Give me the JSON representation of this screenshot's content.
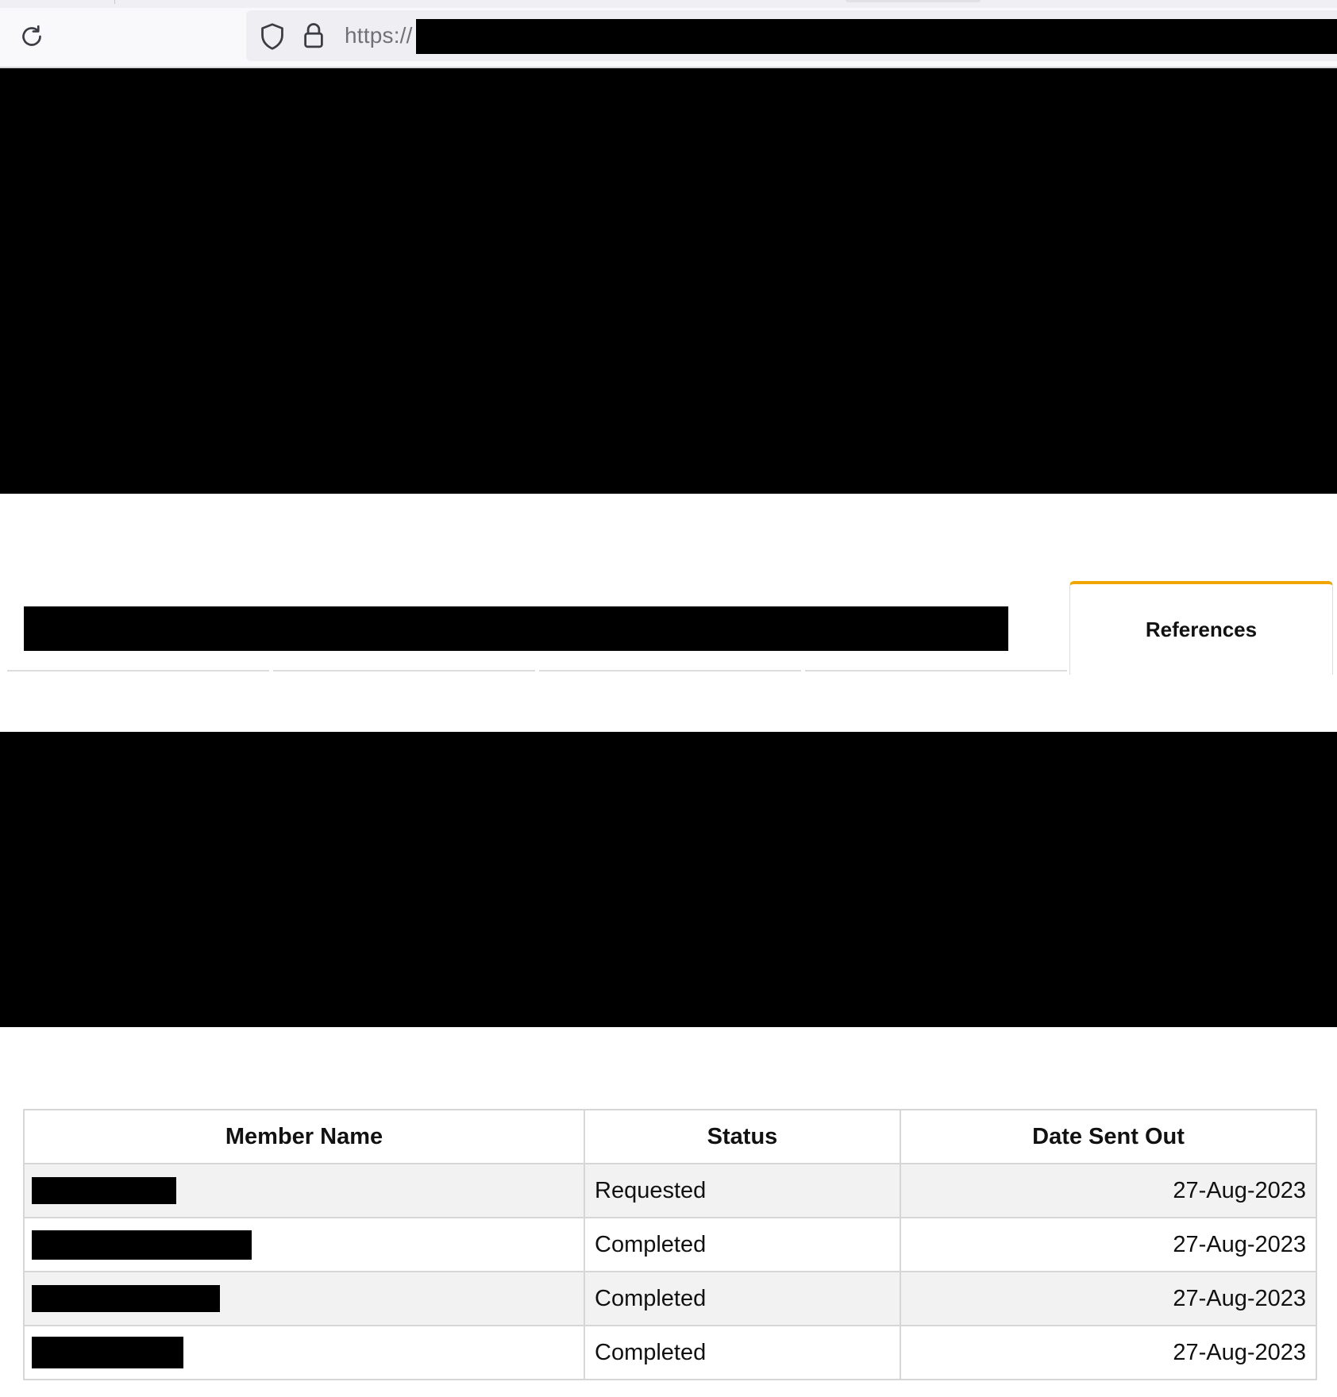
{
  "browser": {
    "url_prefix": "https://",
    "icons": {
      "reload": "reload-icon",
      "tracking_protection": "shield-icon",
      "site_security": "lock-icon"
    }
  },
  "tabs": [
    {
      "label": "References",
      "active": true
    }
  ],
  "accent_color": "#f0a500",
  "references_table": {
    "columns": [
      "Member Name",
      "Status",
      "Date Sent Out"
    ],
    "rows": [
      {
        "status": "Requested",
        "date_sent_out": "27-Aug-2023"
      },
      {
        "status": "Completed",
        "date_sent_out": "27-Aug-2023"
      },
      {
        "status": "Completed",
        "date_sent_out": "27-Aug-2023"
      },
      {
        "status": "Completed",
        "date_sent_out": "27-Aug-2023"
      }
    ]
  }
}
